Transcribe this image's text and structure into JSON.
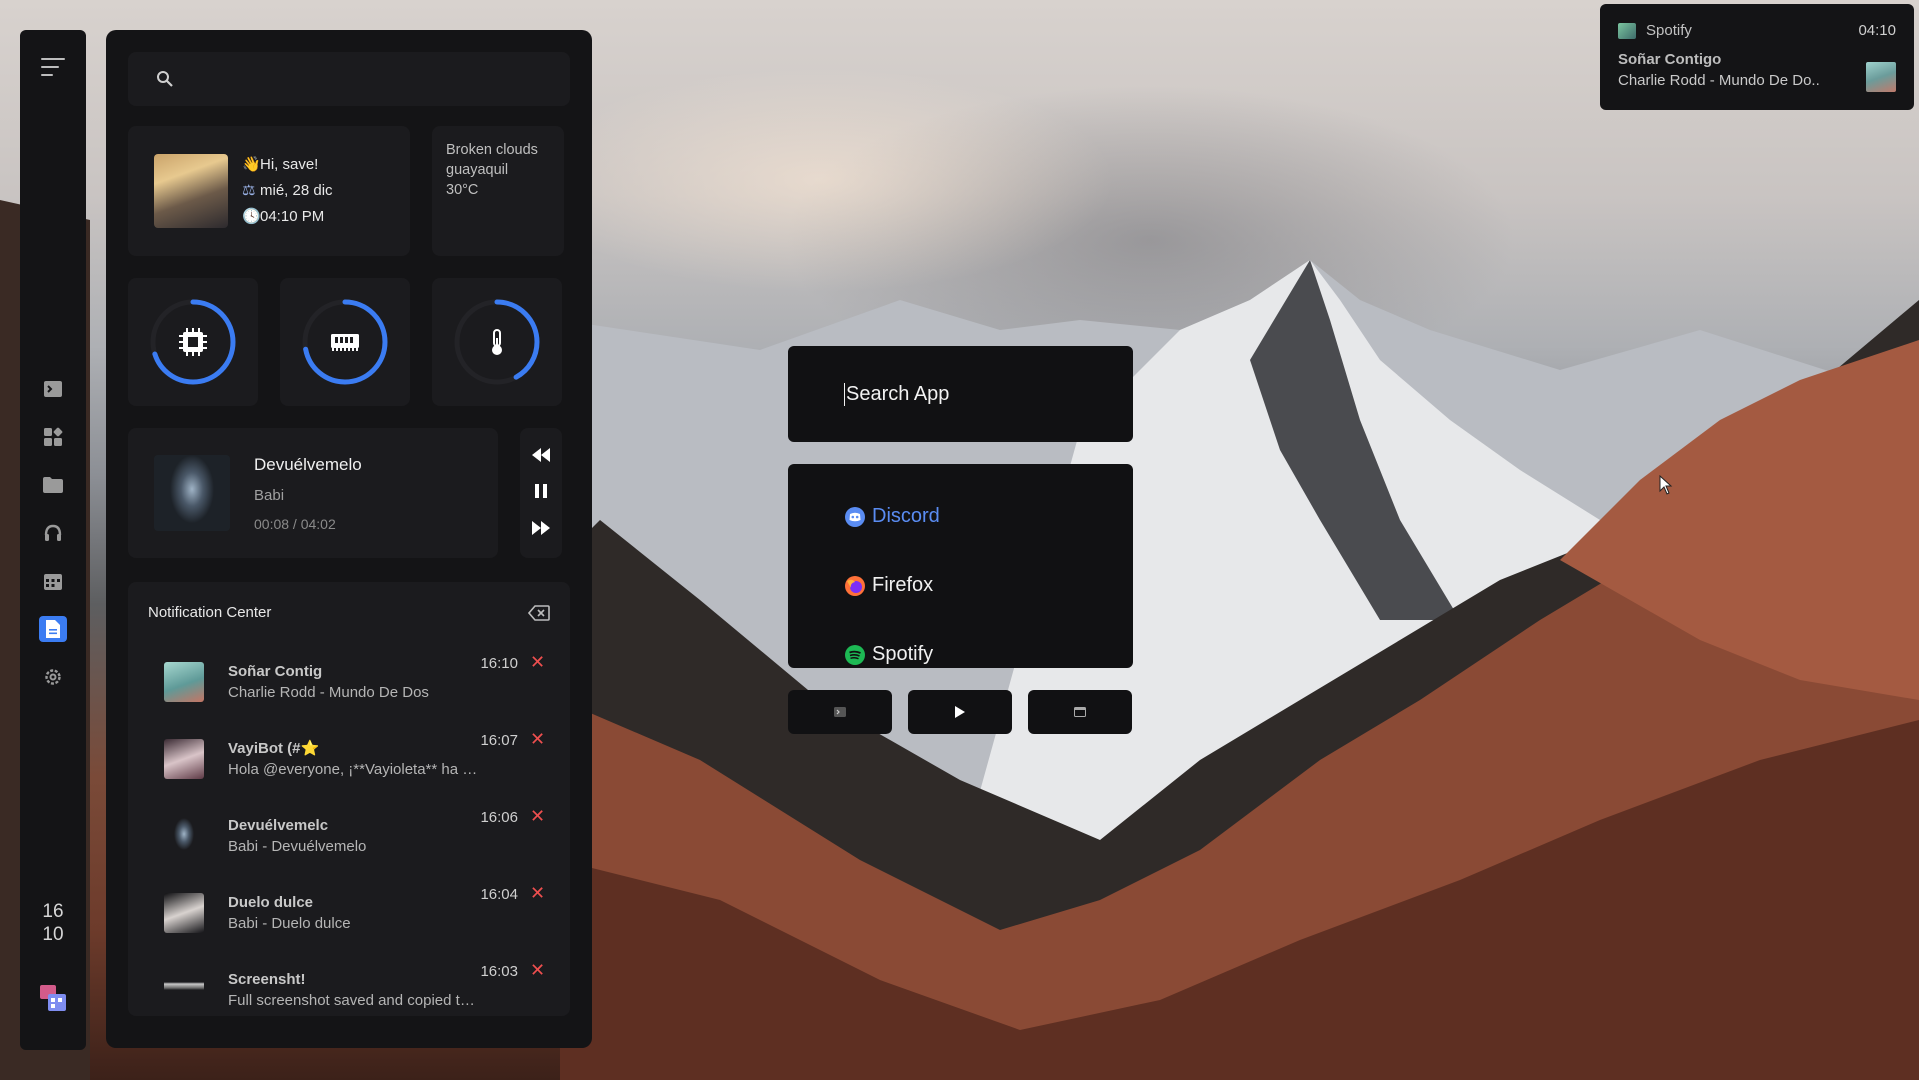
{
  "search": {
    "placeholder": ""
  },
  "profile": {
    "greeting": "Hi, save!",
    "date": "mié, 28 dic",
    "time": "04:10 PM"
  },
  "weather": {
    "condition": "Broken clouds",
    "city": "guayaquil",
    "temp": "30°C"
  },
  "gauges": [
    {
      "name": "cpu",
      "icon": "cpu-icon",
      "level": 0.7
    },
    {
      "name": "ram",
      "icon": "ram-icon",
      "level": 0.72
    },
    {
      "name": "temp",
      "icon": "thermometer-icon",
      "level": 0.42
    }
  ],
  "music": {
    "title": "Devuélvemelo",
    "artist": "Babi",
    "time": "00:08 / 04:02"
  },
  "notification_center": {
    "title": "Notification Center",
    "items": [
      {
        "title": "Soñar Contig",
        "text": "Charlie Rodd - Mundo De Dos",
        "time": "16:10"
      },
      {
        "title": "VayiBot (#⭐️",
        "text": "Hola @everyone, ¡**Vayioleta** ha publica...",
        "time": "16:07"
      },
      {
        "title": "Devuélvemelc",
        "text": "Babi - Devuélvemelo",
        "time": "16:06"
      },
      {
        "title": "Duelo dulce",
        "text": "Babi - Duelo dulce",
        "time": "16:04"
      },
      {
        "title": "Screensht!",
        "text": "Full screenshot saved and copied to clipbo...",
        "time": "16:03"
      }
    ]
  },
  "dock": {
    "clock_hour": "16",
    "clock_min": "10",
    "icons": [
      "terminal-icon",
      "apps-icon",
      "folder-icon",
      "headphones-icon",
      "calendar-icon",
      "document-icon",
      "settings-icon"
    ]
  },
  "launcher": {
    "placeholder": "Search App",
    "apps": [
      {
        "label": "Discord",
        "icon": "discord-icon",
        "color": "#5a8cf2"
      },
      {
        "label": "Firefox",
        "icon": "firefox-icon",
        "color": "#ff7139"
      },
      {
        "label": "Spotify",
        "icon": "spotify-icon",
        "color": "#1db954"
      }
    ]
  },
  "toast": {
    "app": "Spotify",
    "time": "04:10",
    "title": "Soñar Contigo",
    "text": "Charlie Rodd - Mundo De Do.."
  },
  "colors": {
    "accent": "#3b7cf2",
    "close": "#ef4f4f",
    "panel": "#141416",
    "card": "#1b1b1e"
  }
}
